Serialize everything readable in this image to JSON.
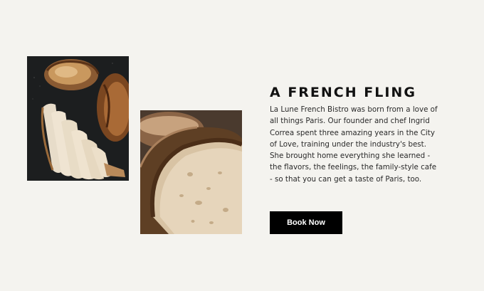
{
  "images": {
    "chicken": {
      "alt": "sliced roasted chicken on a dark board",
      "icon": "chicken-photo"
    },
    "bread": {
      "alt": "sliced sourdough bread loaf",
      "icon": "bread-photo"
    }
  },
  "content": {
    "title": "A FRENCH FLING",
    "description": "La Lune French Bistro was born from a love of all things Paris. Our founder and chef Ingrid Correa spent three amazing years in the City of Love, training under the industry's best. She brought home everything she learned - the flavors, the feelings, the family-style cafe - so that you can get a taste of Paris, too."
  },
  "cta": {
    "label": "Book Now",
    "background": "#000000",
    "color": "#ffffff"
  },
  "colors": {
    "page_background": "#f4f3ef",
    "text": "#111111"
  }
}
